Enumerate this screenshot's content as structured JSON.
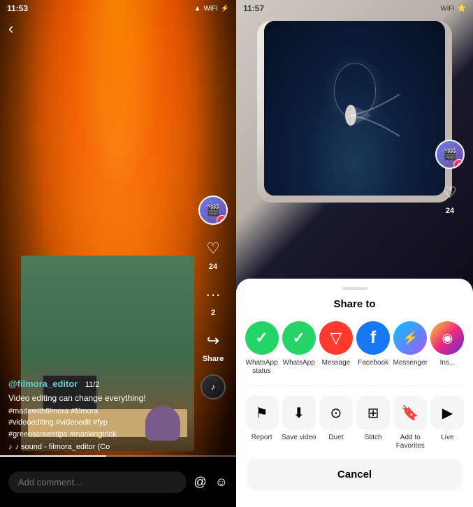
{
  "left": {
    "status": {
      "time": "11:53",
      "signal": "▲",
      "wifi": "WiFi",
      "battery": "⚡"
    },
    "username": "@filmora_editor",
    "date": "11/2",
    "caption": "Video editing can change everything!",
    "hashtags": "#madewithfilmora #filmora\n#videoediting #videoedit #fyp\n#greenscreentips #maskingtrick",
    "sound": "♪ sound - filmora_editor (Co",
    "like_count": "24",
    "comment_count": "2",
    "comment_placeholder": "Add comment...",
    "share_label": "Share",
    "actions": {
      "like": "♡",
      "comment": "···",
      "share": "↪"
    }
  },
  "right": {
    "status": {
      "time": "11:57",
      "signal": "WiFi",
      "battery": "⭐"
    },
    "like_count": "24",
    "share_modal": {
      "title": "Share to",
      "items": [
        {
          "id": "whatsapp-status",
          "label": "WhatsApp status",
          "icon": "✓",
          "bg": "whatsapp"
        },
        {
          "id": "whatsapp",
          "label": "WhatsApp",
          "icon": "✓",
          "bg": "whatsapp"
        },
        {
          "id": "message",
          "label": "Message",
          "icon": "▽",
          "bg": "message"
        },
        {
          "id": "facebook",
          "label": "Facebook",
          "icon": "f",
          "bg": "facebook"
        },
        {
          "id": "messenger",
          "label": "Messenger",
          "icon": "⚡",
          "bg": "messenger"
        },
        {
          "id": "instagram",
          "label": "Ins...",
          "icon": "◉",
          "bg": "instagram"
        }
      ],
      "actions": [
        {
          "id": "report",
          "label": "Report",
          "icon": "⚑"
        },
        {
          "id": "save-video",
          "label": "Save video",
          "icon": "⬇"
        },
        {
          "id": "duet",
          "label": "Duet",
          "icon": "⊙"
        },
        {
          "id": "stitch",
          "label": "Stitch",
          "icon": "⊞"
        },
        {
          "id": "add-favorites",
          "label": "Add to Favorites",
          "icon": "🔖"
        },
        {
          "id": "live",
          "label": "Live",
          "icon": "▶"
        }
      ],
      "cancel": "Cancel"
    }
  }
}
